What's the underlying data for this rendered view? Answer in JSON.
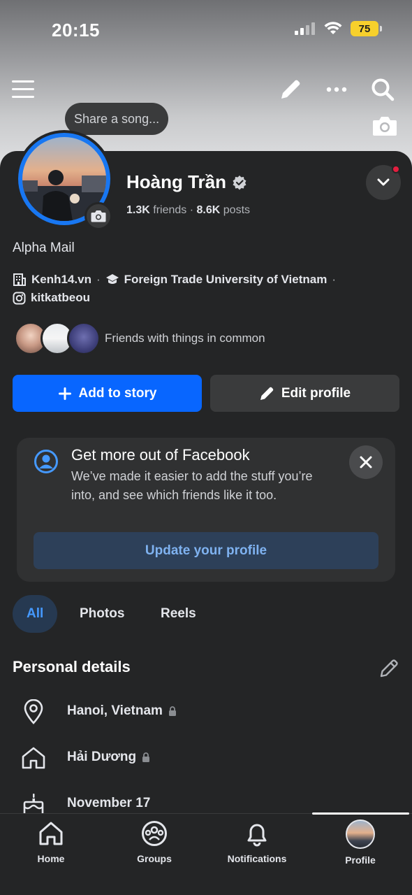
{
  "status_bar": {
    "time": "20:15",
    "battery": "75"
  },
  "header": {
    "icons": [
      "menu-icon",
      "pencil-icon",
      "more-icon",
      "search-icon",
      "camera-icon"
    ]
  },
  "song_prompt": "Share a song...",
  "profile": {
    "name": "Hoàng Trần",
    "friends_count": "1.3K",
    "friends_label": "friends",
    "posts_count": "8.6K",
    "posts_label": "posts",
    "bio": "Alpha Mail",
    "work": "Kenh14.vn",
    "education": "Foreign Trade University of Vietnam",
    "instagram": "kitkatbeou",
    "friends_common_text": "Friends with things in common"
  },
  "actions": {
    "add_story": "Add to story",
    "edit_profile": "Edit profile"
  },
  "promo": {
    "title": "Get more out of Facebook",
    "text": "We’ve made it easier to add the stuff you’re into, and see which friends like it too.",
    "button": "Update your profile"
  },
  "tabs": [
    {
      "label": "All",
      "active": true
    },
    {
      "label": "Photos",
      "active": false
    },
    {
      "label": "Reels",
      "active": false
    }
  ],
  "personal_details": {
    "title": "Personal details",
    "items": [
      {
        "icon": "location-pin-icon",
        "text": "Hanoi, Vietnam",
        "private": true
      },
      {
        "icon": "home-icon",
        "text": "Hải Dương",
        "private": true
      },
      {
        "icon": "birthday-cake-icon",
        "text": "November 17",
        "private": false
      }
    ]
  },
  "bottom_nav": [
    {
      "label": "Home",
      "icon": "home-icon"
    },
    {
      "label": "Groups",
      "icon": "groups-icon"
    },
    {
      "label": "Notifications",
      "icon": "bell-icon"
    },
    {
      "label": "Profile",
      "icon": "profile-avatar",
      "active": true
    }
  ],
  "colors": {
    "accent": "#0866ff",
    "background": "#242526",
    "surface": "#3a3b3c"
  }
}
